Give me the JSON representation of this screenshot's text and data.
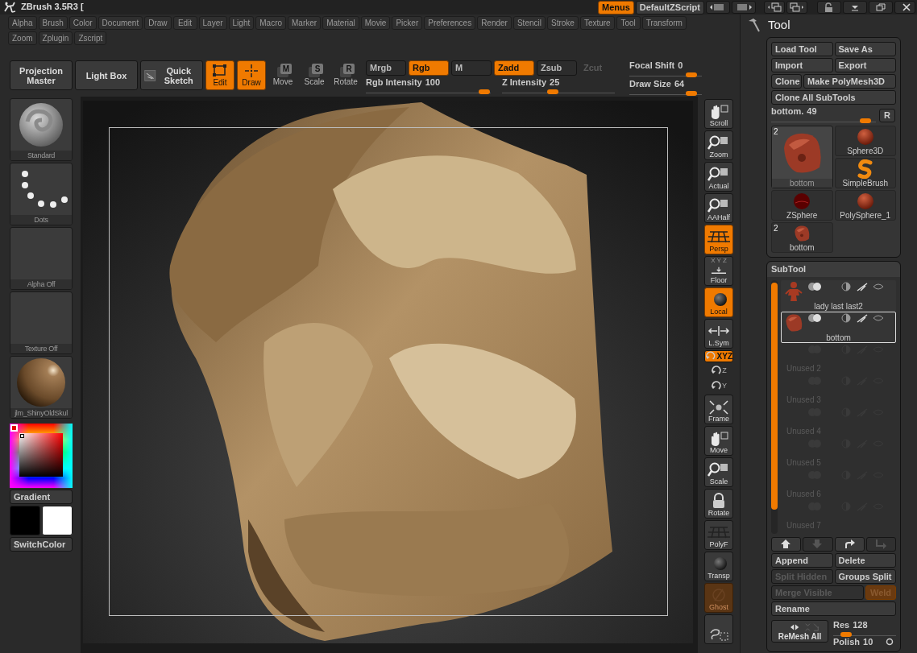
{
  "title": "ZBrush 3.5R3 [",
  "title_buttons": [
    {
      "label": "Menus",
      "selected": true
    },
    {
      "label": "DefaultZScript",
      "selected": false
    }
  ],
  "menu_rows": [
    [
      "Alpha",
      "Brush",
      "Color",
      "Document",
      "Draw",
      "Edit",
      "Layer",
      "Light",
      "Macro",
      "Marker",
      "Material",
      "Movie",
      "Picker",
      "Preferences",
      "Render",
      "Stencil",
      "Stroke",
      "Texture",
      "Tool",
      "Transform"
    ],
    [
      "Zoom",
      "Zplugin",
      "Zscript"
    ]
  ],
  "toolbar": {
    "buttons": [
      {
        "label": "Projection Master"
      },
      {
        "label": "Light Box"
      },
      {
        "label": "Quick Sketch"
      }
    ],
    "modes": [
      {
        "label": "Edit",
        "selected": true,
        "kind": "edit"
      },
      {
        "label": "Draw",
        "selected": true,
        "kind": "draw"
      },
      {
        "label": "Move",
        "key": "M",
        "selected": false,
        "kind": "key"
      },
      {
        "label": "Scale",
        "key": "S",
        "selected": false,
        "kind": "key"
      },
      {
        "label": "Rotate",
        "key": "R",
        "selected": false,
        "kind": "key"
      }
    ],
    "toggles": [
      {
        "label": "Mrgb",
        "on": false,
        "disabled": false
      },
      {
        "label": "Rgb",
        "on": true,
        "disabled": false
      },
      {
        "label": "M",
        "on": false,
        "disabled": false
      },
      {
        "label": "Zadd",
        "on": true,
        "disabled": false
      },
      {
        "label": "Zsub",
        "on": false,
        "disabled": false
      },
      {
        "label": "Zcut",
        "on": false,
        "disabled": true
      }
    ],
    "sliders": [
      {
        "label": "Rgb Intensity",
        "value": "100",
        "level": 0.95
      },
      {
        "label": "Z Intensity",
        "value": "25",
        "level": 0.45
      }
    ],
    "side_sliders": [
      {
        "label": "Focal Shift",
        "value": "0",
        "level": 0.85
      },
      {
        "label": "Draw Size",
        "value": "64",
        "level": 0.85
      }
    ]
  },
  "left_shelf": [
    {
      "label": "Standard",
      "kind": "brush"
    },
    {
      "label": "Dots",
      "kind": "stroke"
    },
    {
      "label": "Alpha  Off",
      "kind": "alpha"
    },
    {
      "label": "Texture  Off",
      "kind": "texture"
    },
    {
      "label": "jlm_ShinyOldSkul",
      "kind": "material"
    }
  ],
  "gradient_label": "Gradient",
  "swatches": [
    {
      "color": "#000000"
    },
    {
      "color": "#ffffff"
    }
  ],
  "switch_label": "SwitchColor",
  "right_shelf": [
    {
      "label": "Scroll",
      "kind": "hand",
      "selected": false,
      "disabled": false
    },
    {
      "label": "Zoom",
      "kind": "magnifier",
      "selected": false,
      "disabled": false
    },
    {
      "label": "Actual",
      "kind": "magnifier",
      "selected": false,
      "disabled": false
    },
    {
      "label": "AAHalf",
      "kind": "magnifier",
      "selected": false,
      "disabled": false
    },
    {
      "label": "Persp",
      "kind": "grid",
      "selected": true,
      "disabled": false
    },
    {
      "label": "Floor",
      "kind": "floor",
      "axes": "X Y Z",
      "selected": false,
      "disabled": false
    },
    {
      "label": "Local",
      "kind": "sphere",
      "selected": true,
      "disabled": false
    },
    {
      "label": "L.Sym",
      "kind": "sym",
      "selected": false,
      "disabled": false
    },
    {
      "label": "XYZ",
      "kind": "pill",
      "selected": true
    },
    {
      "label": "Z",
      "kind": "mini"
    },
    {
      "label": "Y",
      "kind": "mini"
    },
    {
      "label": "Frame",
      "kind": "frame",
      "selected": false,
      "disabled": false
    },
    {
      "label": "Move",
      "kind": "hand",
      "selected": false,
      "disabled": false
    },
    {
      "label": "Scale",
      "kind": "magnifier",
      "selected": false,
      "disabled": false
    },
    {
      "label": "Rotate",
      "kind": "lock",
      "selected": false,
      "disabled": false
    },
    {
      "label": "PolyF",
      "kind": "grid",
      "selected": false,
      "disabled": false
    },
    {
      "label": "Transp",
      "kind": "sphere",
      "selected": false,
      "disabled": false
    },
    {
      "label": "Ghost",
      "kind": "slash",
      "selected": true,
      "disabled": true
    },
    {
      "kind": "lasso",
      "selected": false,
      "disabled": false
    }
  ],
  "tool_panel": {
    "title": "Tool",
    "buttons": [
      "Load Tool",
      "Save As",
      "Import",
      "Export",
      "Clone",
      "Make PolyMesh3D",
      "Clone All SubTools"
    ],
    "slider": {
      "label": "bottom.",
      "value": "49",
      "level": 0.9,
      "reset": "R"
    },
    "tools": [
      {
        "label": "bottom",
        "badge": "2",
        "kind": "blob",
        "selected": true
      },
      {
        "label": "Sphere3D",
        "kind": "sphere",
        "selected": false
      },
      {
        "label": "SimpleBrush",
        "kind": "brush",
        "selected": false
      },
      {
        "label": "ZSphere",
        "kind": "zsphere",
        "selected": false
      },
      {
        "label": "PolySphere_1",
        "kind": "sphere",
        "selected": false
      },
      {
        "label": "bottom",
        "badge": "2",
        "kind": "blob",
        "selected": false
      }
    ]
  },
  "subtool_panel": {
    "title": "SubTool",
    "rows": [
      {
        "label": "lady  last last2",
        "kind": "figure",
        "selected": false
      },
      {
        "label": "bottom",
        "kind": "blob",
        "selected": true
      },
      {
        "label": "Unused 2",
        "kind": "empty",
        "selected": false
      },
      {
        "label": "Unused 3",
        "kind": "empty",
        "selected": false
      },
      {
        "label": "Unused 4",
        "kind": "empty",
        "selected": false
      },
      {
        "label": "Unused 5",
        "kind": "empty",
        "selected": false
      },
      {
        "label": "Unused 6",
        "kind": "empty",
        "selected": false
      },
      {
        "label": "Unused 7",
        "kind": "empty",
        "selected": false
      }
    ],
    "arrow_buttons": [
      {
        "disabled": false
      },
      {
        "disabled": true
      },
      {
        "disabled": false
      },
      {
        "disabled": true
      }
    ],
    "button_rows": [
      [
        {
          "label": "Append",
          "disabled": false,
          "selected": false
        },
        {
          "label": "Delete",
          "disabled": false,
          "selected": false
        }
      ],
      [
        {
          "label": "Split Hidden",
          "disabled": true,
          "selected": false
        },
        {
          "label": "Groups Split",
          "disabled": false,
          "selected": false
        }
      ],
      [
        {
          "label": "Merge Visible",
          "disabled": true,
          "selected": false
        },
        {
          "label": "Weld",
          "disabled": true,
          "selected": true
        }
      ],
      [
        {
          "label": "Rename",
          "disabled": false,
          "selected": false
        }
      ]
    ],
    "remesh": {
      "label": "ReMesh All"
    },
    "res": {
      "label": "Res",
      "value": "128",
      "level": 0.2
    },
    "polish": {
      "label": "Polish",
      "value": "10"
    }
  }
}
